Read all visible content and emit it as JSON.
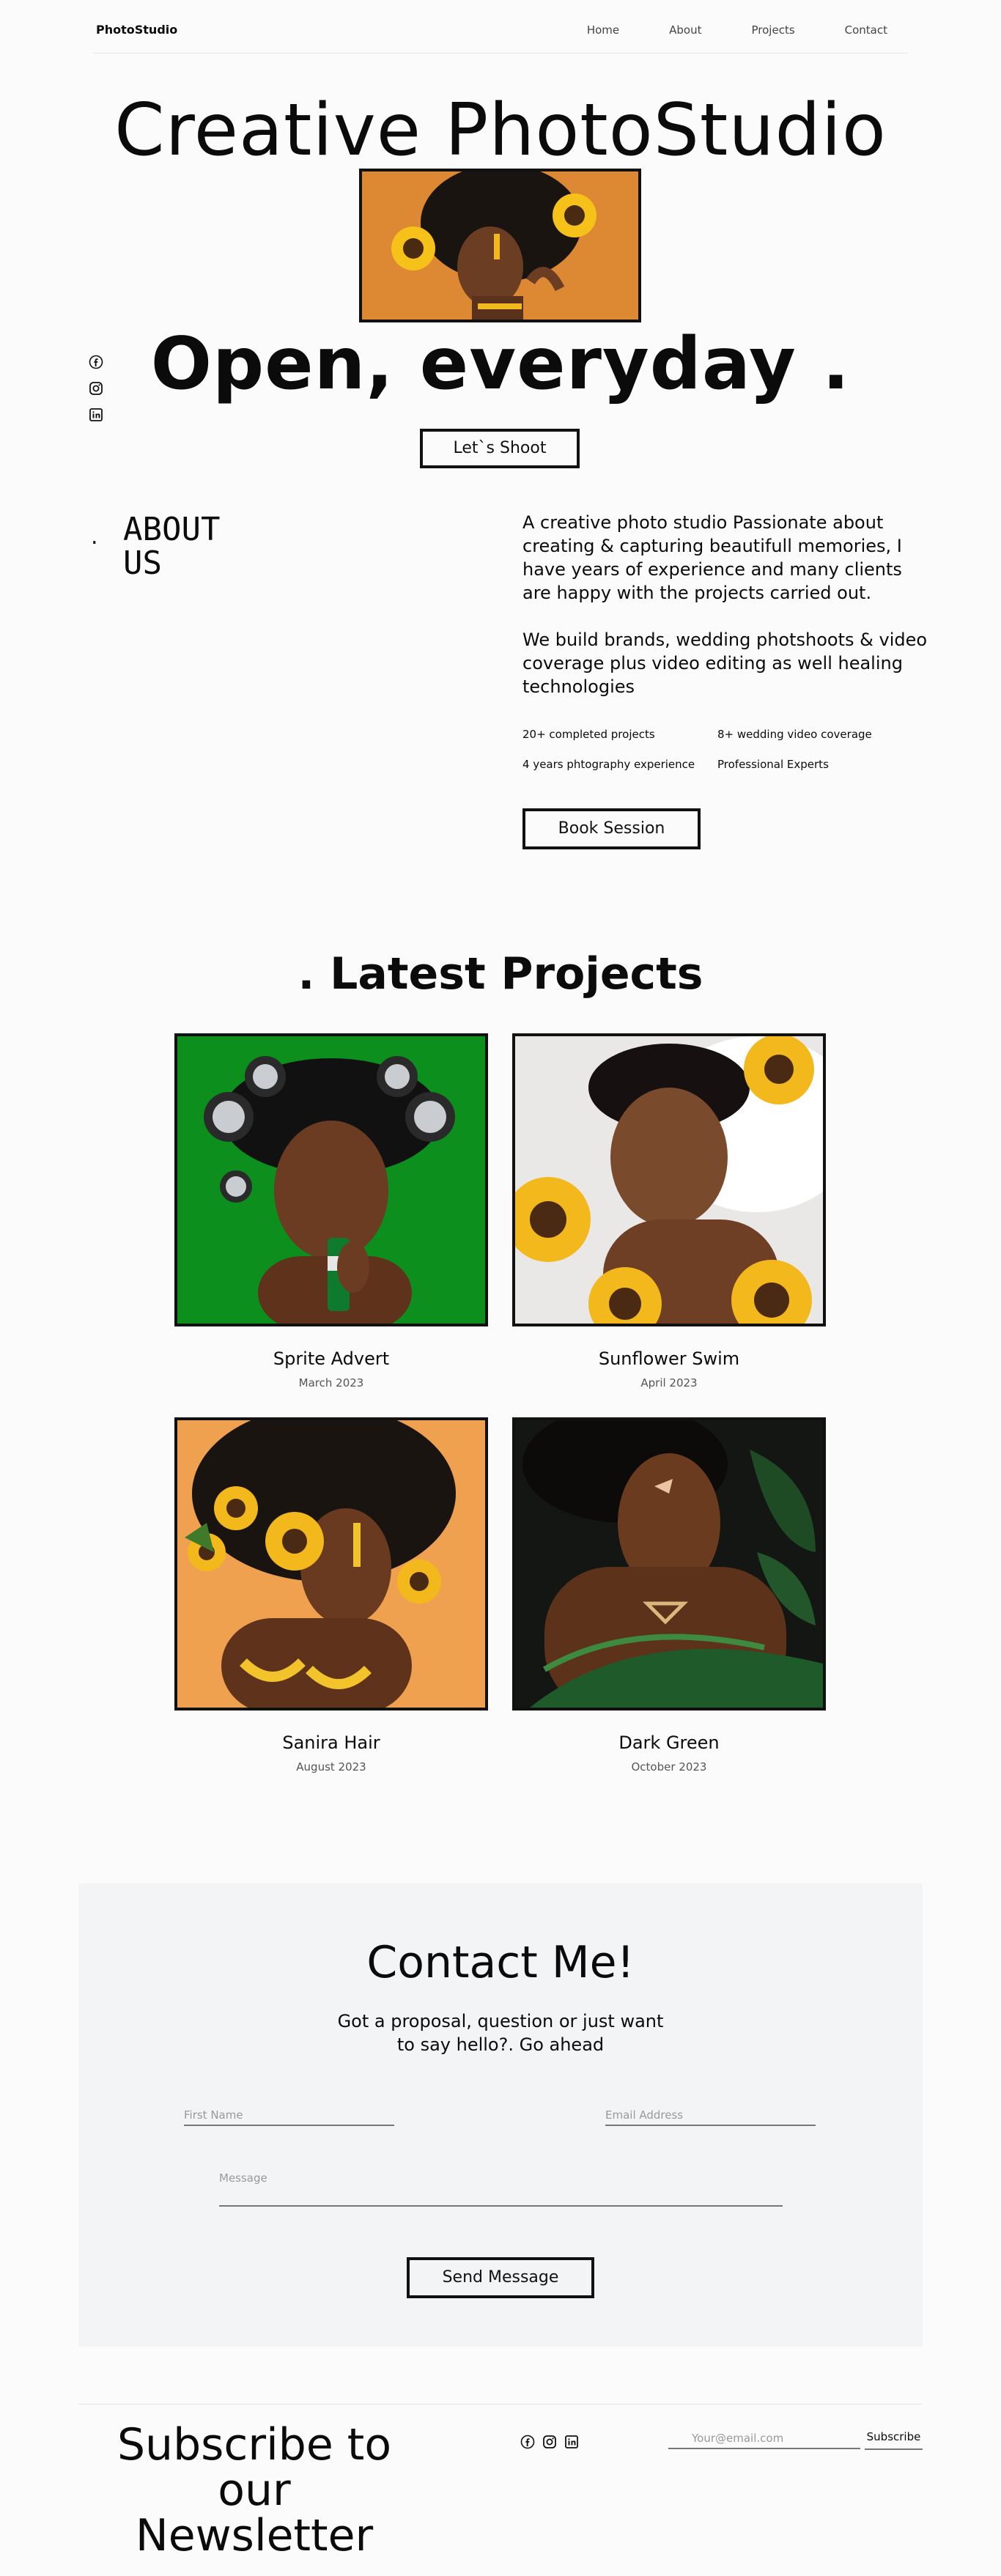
{
  "nav": {
    "brand": "PhotoStudio",
    "links": [
      "Home",
      "About",
      "Projects",
      "Contact"
    ]
  },
  "hero": {
    "title": "Creative PhotoStudio",
    "subtitle": "Open, everyday .",
    "cta": "Let`s Shoot"
  },
  "social": [
    "facebook-icon",
    "instagram-icon",
    "linkedin-icon"
  ],
  "about": {
    "dot": ".",
    "title_line1": "ABOUT",
    "title_line2": "US",
    "paragraph1": "A creative photo studio Passionate about creating & capturing beautifull memories, I have years of experience and many clients are happy with the projects carried out.",
    "paragraph2": "We build brands, wedding photshoots & video coverage plus video editing as well healing technologies",
    "stats": [
      "20+ completed projects",
      "8+ wedding video coverage",
      "4 years phtography experience",
      "Professional Experts"
    ],
    "cta": "Book Session"
  },
  "projects": {
    "title": ". Latest Projects",
    "items": [
      {
        "name": "Sprite Advert",
        "date": "March 2023"
      },
      {
        "name": "Sunflower Swim",
        "date": "April 2023"
      },
      {
        "name": "Sanira Hair",
        "date": "August 2023"
      },
      {
        "name": "Dark Green",
        "date": "October 2023"
      }
    ]
  },
  "contact": {
    "title": "Contact Me!",
    "lead_line1": "Got a proposal, question or just want",
    "lead_line2": "to say hello?. Go ahead",
    "first_name_placeholder": "First Name",
    "email_placeholder": "Email Address",
    "message_placeholder": "Message",
    "submit": "Send Message"
  },
  "newsletter": {
    "title_line1": "Subscribe to our",
    "title_line2": "Newsletter",
    "email_placeholder": "Your@email.com",
    "submit": "Subscribe"
  }
}
